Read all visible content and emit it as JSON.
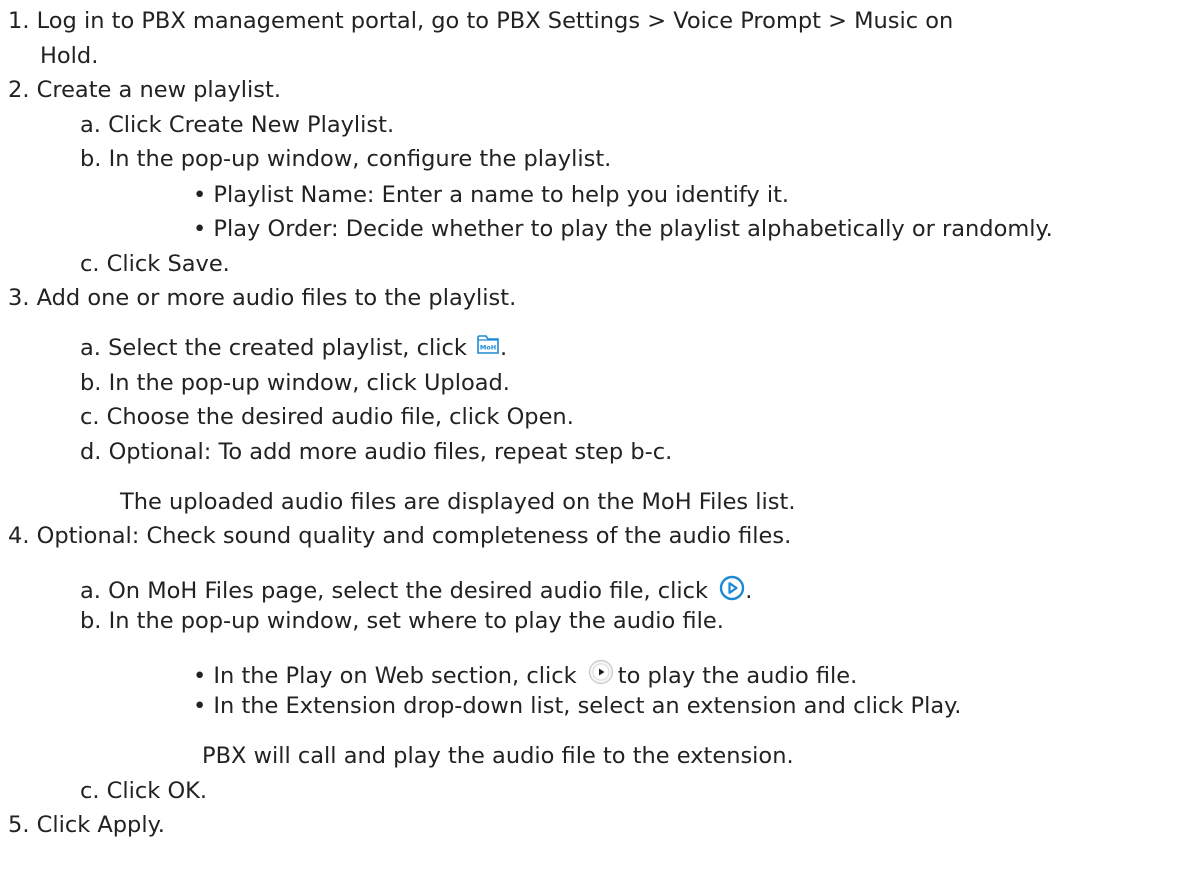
{
  "steps": {
    "s1_line1": "1. Log in to PBX management portal, go to PBX Settings > Voice Prompt > Music on",
    "s1_line2": "Hold.",
    "s2": "2. Create a new playlist.",
    "s2a": "a. Click Create New Playlist.",
    "s2b": "b. In the pop-up window, configure the playlist.",
    "s2b_bullet1": "• Playlist Name: Enter a name to help you identify it.",
    "s2b_bullet2": "• Play Order: Decide whether to play the playlist alphabetically or randomly.",
    "s2c": "c. Click Save.",
    "s3": "3. Add one or more audio files to the playlist.",
    "s3a_before": "a. Select the created playlist, click ",
    "s3a_after": ".",
    "s3b": "b. In the pop-up window, click Upload.",
    "s3c": "c. Choose the desired audio file, click Open.",
    "s3d": "d. Optional: To add more audio files, repeat step b-c.",
    "s3_result": "The uploaded audio files are displayed on the MoH Files list.",
    "s4": "4. Optional: Check sound quality and completeness of the audio files.",
    "s4a_before": "a. On MoH Files page, select the desired audio file, click ",
    "s4a_after": ".",
    "s4b": "b. In the pop-up window, set where to play the audio file.",
    "s4b_bullet1_before": "• In the Play on Web section, click ",
    "s4b_bullet1_after": "to play the audio file.",
    "s4b_bullet2": "• In the Extension drop-down list, select an extension and click Play.",
    "s4b_result": "PBX will call and play the audio file to the extension.",
    "s4c": "c. Click OK.",
    "s5": "5. Click Apply."
  },
  "icons": {
    "moh_icon": "moh-file-icon",
    "moh_icon_text": "MoH",
    "play_blue_icon": "play-circle-icon",
    "play_grey_icon": "play-button-icon"
  },
  "colors": {
    "text": "#222222",
    "icon_blue": "#1a8ad4",
    "icon_grey": "#bdbdbd"
  }
}
